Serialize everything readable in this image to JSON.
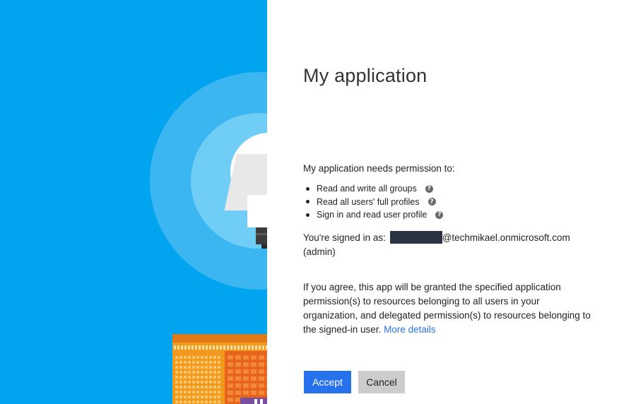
{
  "app": {
    "title": "My application"
  },
  "permissions": {
    "intro": "My application needs permission to:",
    "items": [
      {
        "label": "Read and write all groups",
        "help_icon": "?"
      },
      {
        "label": "Read all users' full profiles",
        "help_icon": "?"
      },
      {
        "label": "Sign in and read user profile",
        "help_icon": "?"
      }
    ]
  },
  "account": {
    "prefix": "You're signed in as:",
    "domain": "@techmikael.onmicrosoft.com",
    "role": "(admin)"
  },
  "consent": {
    "text": "If you agree, this app will be granted the specified application permission(s) to resources belonging to all users in your organization, and delegated permission(s) to resources belonging to the signed-in user.",
    "more_link": "More details"
  },
  "buttons": {
    "accept": "Accept",
    "cancel": "Cancel"
  },
  "colors": {
    "hero_blue": "#00a4ef",
    "accent": "#2672ec"
  }
}
